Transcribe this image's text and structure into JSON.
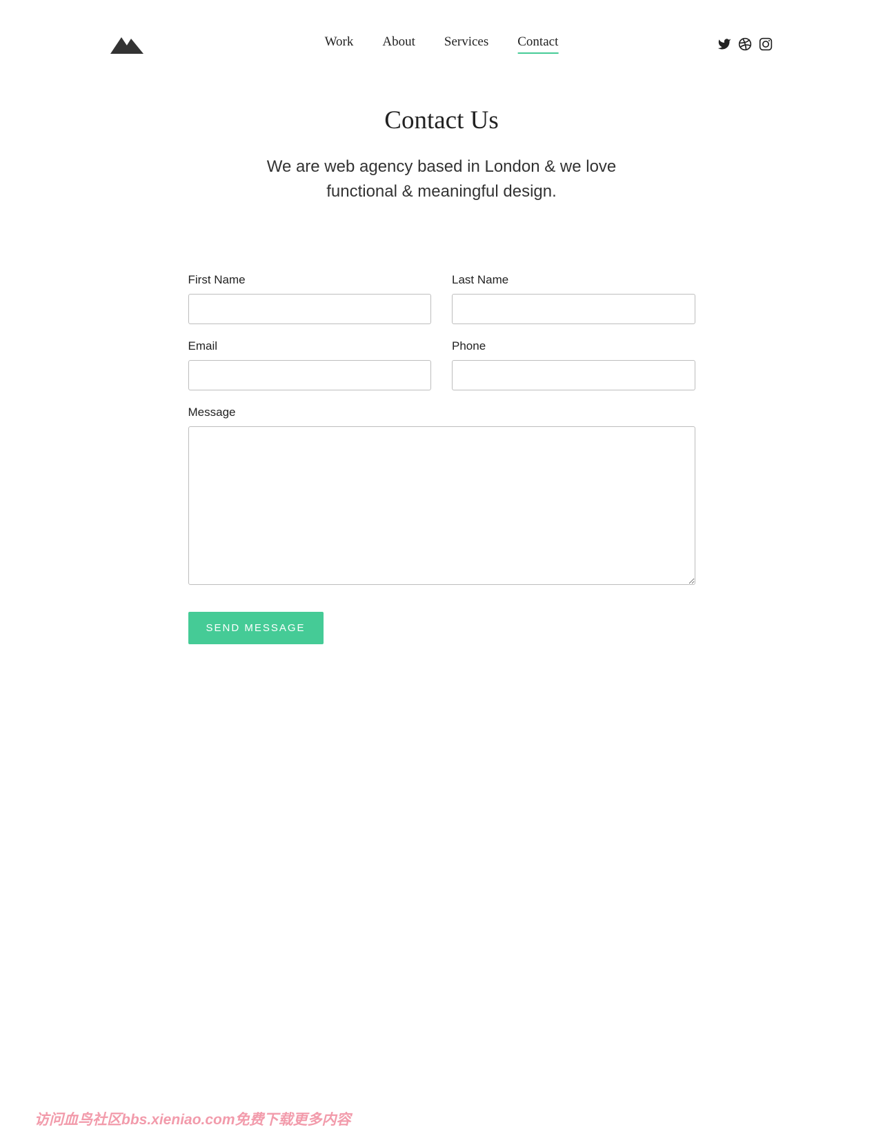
{
  "nav": {
    "items": [
      {
        "label": "Work",
        "active": false
      },
      {
        "label": "About",
        "active": false
      },
      {
        "label": "Services",
        "active": false
      },
      {
        "label": "Contact",
        "active": true
      }
    ]
  },
  "hero": {
    "title": "Contact Us",
    "subtitle": "We are web agency based in London & we love functional & meaningful design."
  },
  "form": {
    "first_name": {
      "label": "First Name",
      "value": ""
    },
    "last_name": {
      "label": "Last Name",
      "value": ""
    },
    "email": {
      "label": "Email",
      "value": ""
    },
    "phone": {
      "label": "Phone",
      "value": ""
    },
    "message": {
      "label": "Message",
      "value": ""
    },
    "submit_label": "SEND MESSAGE"
  },
  "watermark": "访问血鸟社区bbs.xieniao.com免费下载更多内容"
}
